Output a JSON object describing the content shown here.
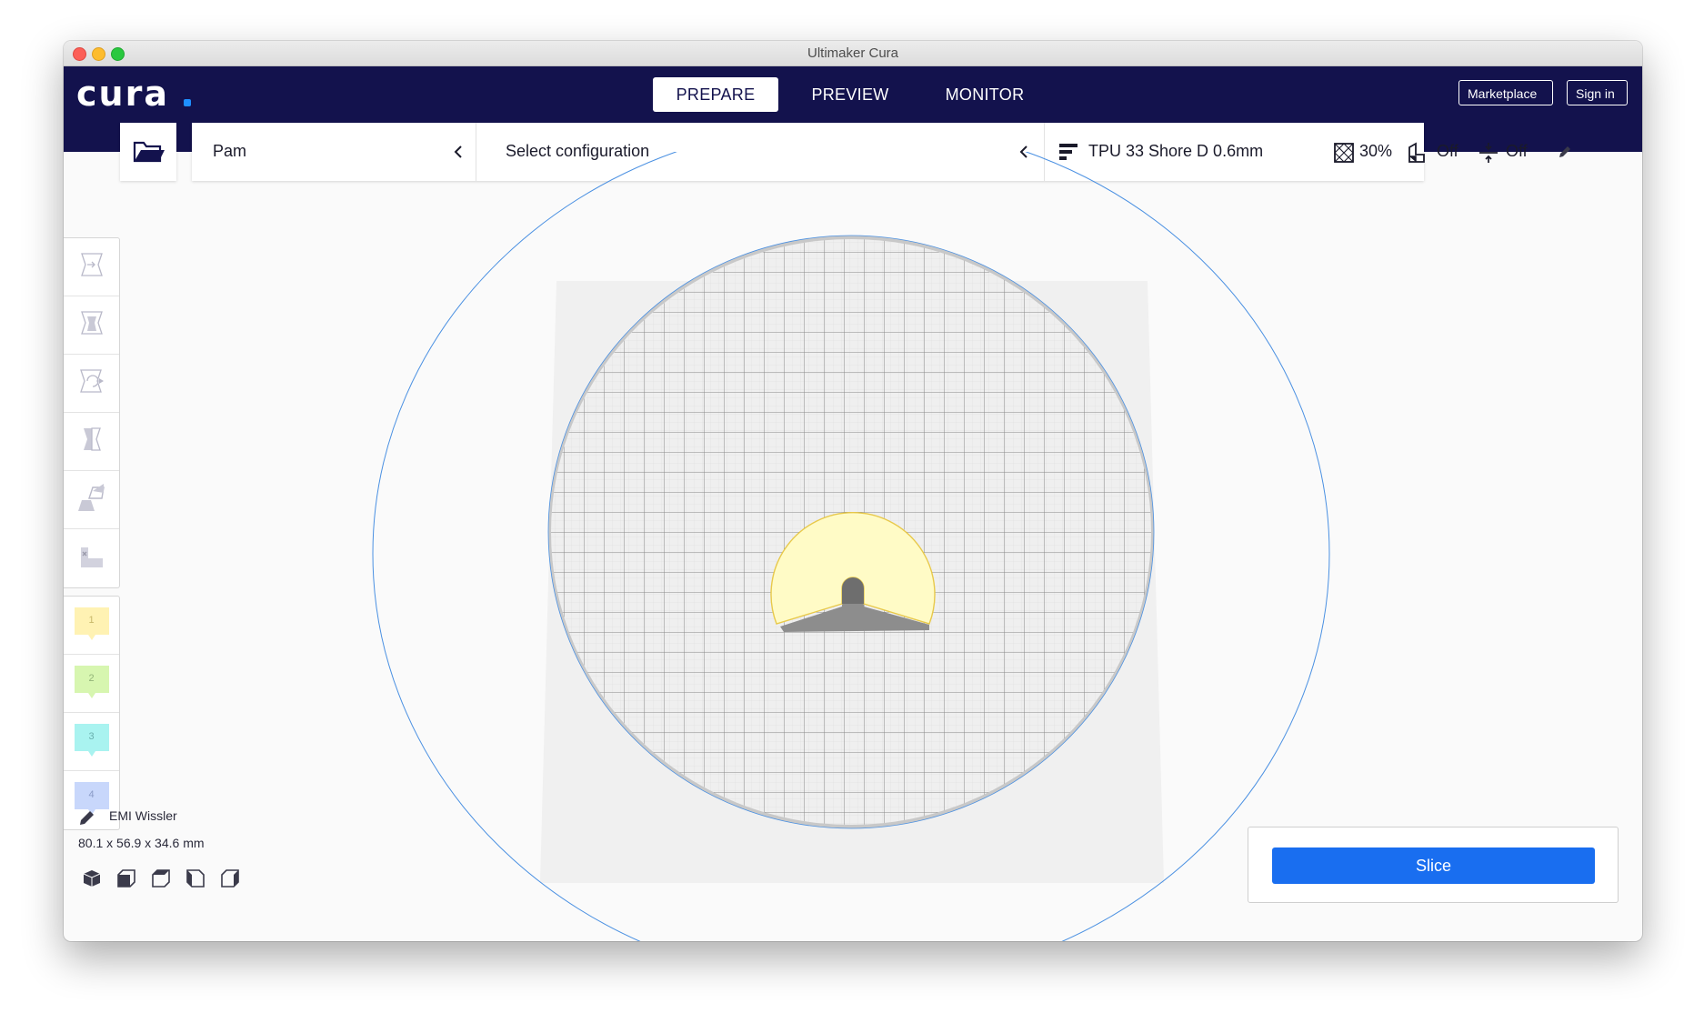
{
  "window": {
    "title": "Ultimaker Cura"
  },
  "header": {
    "logo_text": "cura",
    "tabs": [
      {
        "label": "PREPARE",
        "active": true
      },
      {
        "label": "PREVIEW",
        "active": false
      },
      {
        "label": "MONITOR",
        "active": false
      }
    ],
    "marketplace_label": "Marketplace",
    "signin_label": "Sign in"
  },
  "stage_menu": {
    "printer": "Pam",
    "configuration": "Select configuration",
    "material_profile": "TPU 33 Shore D 0.6mm",
    "infill": "30%",
    "support": "Off",
    "adhesion": "Off"
  },
  "toolbar": {
    "tools": [
      "move-tool",
      "scale-tool",
      "rotate-tool",
      "mirror-tool",
      "per-model-settings-tool",
      "support-blocker-tool"
    ],
    "extruders": [
      {
        "number": "1",
        "color": "#fff2b3"
      },
      {
        "number": "2",
        "color": "#d7f6b0"
      },
      {
        "number": "3",
        "color": "#a9f3f0"
      },
      {
        "number": "4",
        "color": "#c8d7fb"
      }
    ]
  },
  "object_info": {
    "name": "EMI Wissler",
    "dimensions": "80.1 x 56.9 x 34.6 mm"
  },
  "view_orientation": [
    "3d-view",
    "front-view",
    "top-view",
    "left-view",
    "right-view"
  ],
  "slice": {
    "label": "Slice"
  },
  "colors": {
    "header_bg": "#13124d",
    "accent_blue": "#196ef0",
    "model_fill": "#fffbc6",
    "model_outline": "#e8c94a",
    "boundary_line": "#4a90e2"
  }
}
